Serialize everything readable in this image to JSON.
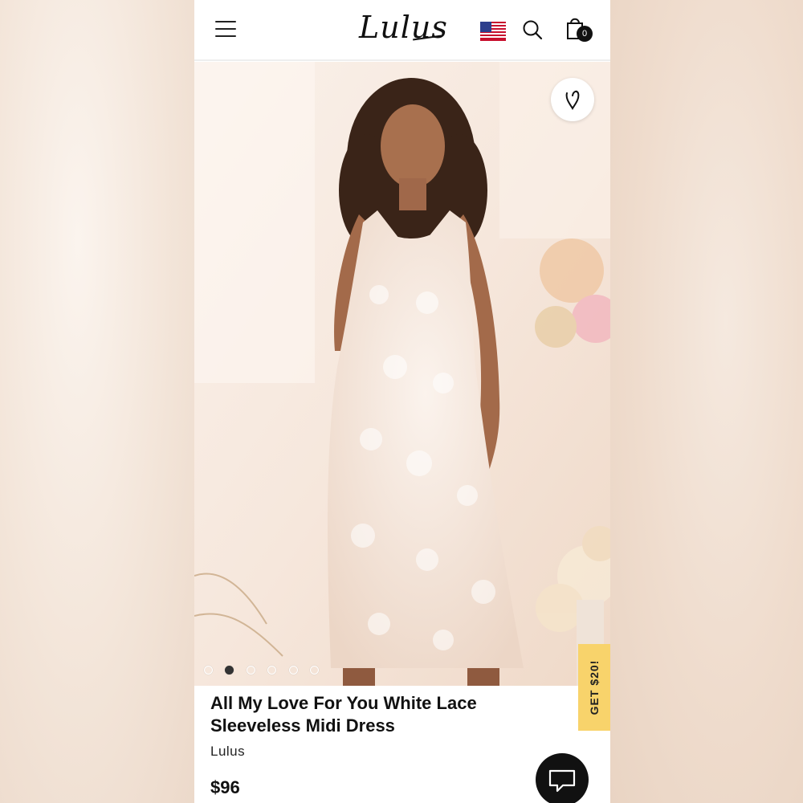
{
  "header": {
    "logo_text": "Lulus",
    "menu_icon": "hamburger-menu-icon",
    "flag_icon": "us-flag-icon",
    "search_icon": "search-icon",
    "cart_icon": "shopping-bag-icon",
    "cart_count": "0"
  },
  "gallery": {
    "slide_count": 6,
    "active_slide": 2,
    "wishlist_icon": "heart-icon"
  },
  "promo": {
    "label": "GET $20!",
    "color": "#f8d36b"
  },
  "product": {
    "title": "All My Love For You White Lace Sleeveless Midi Dress",
    "brand": "Lulus",
    "price": "$96"
  },
  "chat": {
    "icon": "chat-bubble-icon"
  }
}
